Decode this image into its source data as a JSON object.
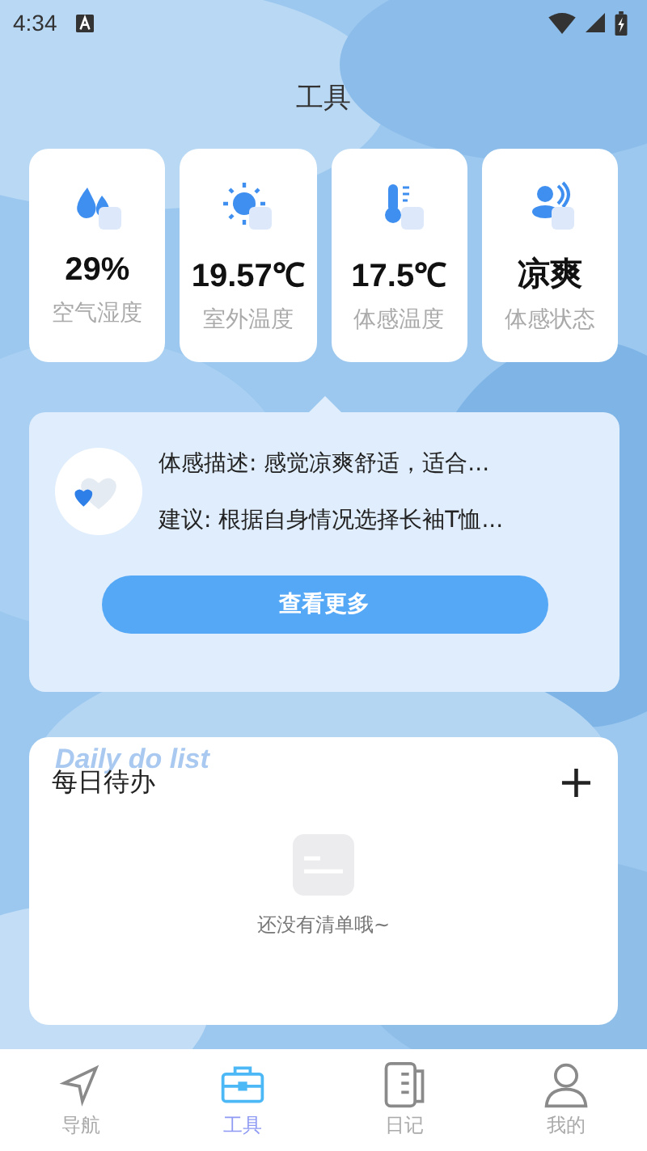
{
  "status_bar": {
    "time": "4:34"
  },
  "header": {
    "title": "工具"
  },
  "stats": [
    {
      "kind": "humidity",
      "value": "29%",
      "label": "空气湿度"
    },
    {
      "kind": "sun",
      "value": "19.57℃",
      "label": "室外温度"
    },
    {
      "kind": "thermometer",
      "value": "17.5℃",
      "label": "体感温度"
    },
    {
      "kind": "person",
      "value": "凉爽",
      "label": "体感状态"
    }
  ],
  "advice": {
    "description": "体感描述: 感觉凉爽舒适，适合...",
    "suggestion": "建议: 根据自身情况选择长袖T恤...",
    "button": "查看更多"
  },
  "todo": {
    "watermark": "Daily do list",
    "title": "每日待办",
    "add": "+",
    "empty": "还没有清单哦~"
  },
  "tabs": [
    {
      "kind": "nav",
      "label": "导航",
      "selected": false
    },
    {
      "kind": "tools",
      "label": "工具",
      "selected": true
    },
    {
      "kind": "diary",
      "label": "日记",
      "selected": false
    },
    {
      "kind": "me",
      "label": "我的",
      "selected": false
    }
  ]
}
